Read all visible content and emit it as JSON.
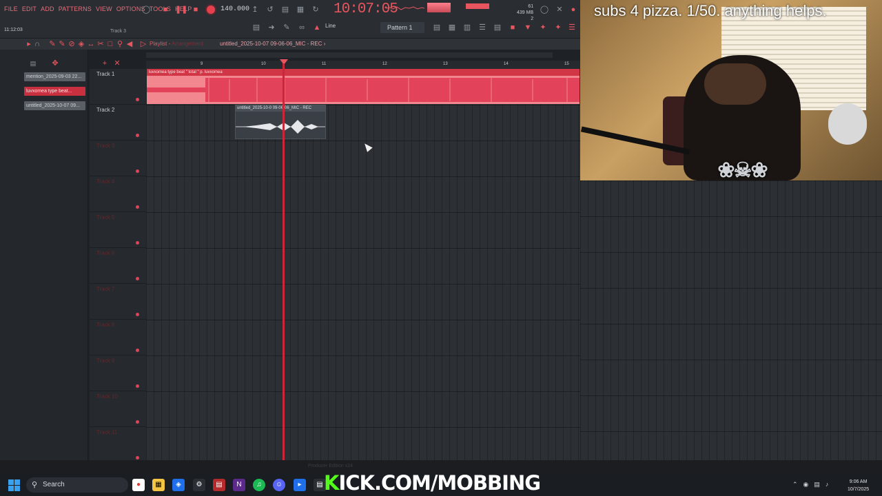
{
  "menu": [
    "FILE",
    "EDIT",
    "ADD",
    "PATTERNS",
    "VIEW",
    "OPTIONS",
    "TOOLS",
    "HELP"
  ],
  "transport": {
    "tempo": "140.000",
    "time": "10:07:05",
    "pattern": "Pattern 1",
    "snap": "Line",
    "memory": "439 MB",
    "mem_top": "61",
    "mem_bottom": "2",
    "clock_small": "11:12:03",
    "hint": "Track 3"
  },
  "playlist": {
    "title": "Playlist",
    "title_suffix": "Arrangement",
    "file": "untitled_2025-10-07 09-06-06_MIC",
    "file_tag": "REC"
  },
  "ruler": [
    "9",
    "10",
    "11",
    "12",
    "13",
    "14",
    "15"
  ],
  "picker": [
    {
      "label": "mention_2025-09-03 22...",
      "selected": false
    },
    {
      "label": "luvxomea type beat...",
      "selected": true
    },
    {
      "label": "untitled_2025-10-07 09...",
      "selected": false
    }
  ],
  "tracks": [
    "Track 1",
    "Track 2",
    "Track 3",
    "Track 4",
    "Track 5",
    "Track 6",
    "Track 7",
    "Track 8",
    "Track 9",
    "Track 10",
    "Track 11"
  ],
  "clips": {
    "clip1_title": "luvxomea type beat \" total \" p. luvxomea",
    "clip2_title": "untitled_2025-10-0 09-06-06_MIC - REC"
  },
  "overlay": {
    "text": "subs 4 pizza. 1/50. anything helps."
  },
  "status": {
    "producer": "Producer Edition v24"
  },
  "taskbar": {
    "search": "Search",
    "kick_prefix": "K",
    "kick_rest": "ICK.COM/MOBBING",
    "time": "9:06 AM",
    "date": "10/7/2025"
  },
  "colors": {
    "accent": "#e8555f",
    "clip1": "#f3878f",
    "playhead": "#c8283a"
  }
}
